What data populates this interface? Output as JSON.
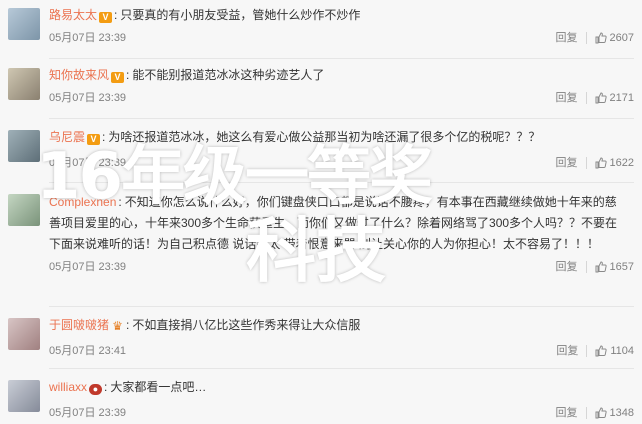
{
  "reply_label": "回复",
  "comments": [
    {
      "user": "路易太太",
      "badge": "vip-icon",
      "text": "只要真的有小朋友受益，管她什么炒作不炒作",
      "time": "05月07日 23:39",
      "likes": "2607"
    },
    {
      "user": "知你故来风",
      "badge": "v-icon",
      "text": "能不能别报道范冰冰这种劣迹艺人了",
      "time": "05月07日 23:39",
      "likes": "2171"
    },
    {
      "user": "乌尼震",
      "badge": "vip-icon",
      "text": "为啥还报道范冰冰，她这么有爱心做公益那当初为啥还漏了很多个亿的税呢？？？",
      "time": "05月07日 23:39",
      "likes": "1622"
    },
    {
      "user": "Complexnen",
      "badge": "",
      "text": "不知道你怎么说什么好，你们键盘侠口口都是说话不腰疼，有本事在西藏继续做她十年来的慈善项目爱里的心，十年来300多个生命获重生，而你们又做过了什么？除着网络骂了300多个人吗？？不要在下面来说难听的话！为自己积点德 说话别太 带着恨意来骂 别让关心你的人为你担心！太不容易了！！！",
      "time": "05月07日 23:39",
      "likes": "1657"
    },
    {
      "user": "于圆啵啵猪",
      "badge": "crown-icon",
      "text": "不如直接捐八亿比这些作秀来得让大众信服",
      "time": "05月07日 23:41",
      "likes": "1104"
    },
    {
      "user": "williaxx",
      "badge": "badge-icon",
      "text": "大家都看一点吧…",
      "time": "05月07日 23:39",
      "likes": "1348"
    }
  ],
  "watermark": {
    "line1": "16年级一等奖",
    "line2": "科技"
  }
}
